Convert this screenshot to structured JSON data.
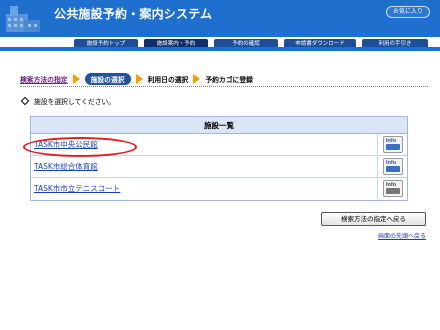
{
  "header": {
    "title": "公共施設予約・案内システム",
    "favorites_label": "お気に入り",
    "bg_color": "#1f6fcf"
  },
  "nav": {
    "tabs": [
      {
        "label": "施設予約トップ",
        "active": false
      },
      {
        "label": "施設案内・予約",
        "active": true
      },
      {
        "label": "予約の確認",
        "active": false
      },
      {
        "label": "申請書ダウンロード",
        "active": false
      },
      {
        "label": "利用の手引き",
        "active": false
      }
    ]
  },
  "breadcrumb": {
    "step1": "検索方法の指定",
    "step2": "施設の選択",
    "step3": "利用日の選択",
    "step4": "予約カゴに登録"
  },
  "instruction": "施設を選択してください。",
  "facility_table": {
    "header": "施設一覧",
    "rows": [
      {
        "name": "TASK市中央公民館",
        "info_icon": "info-icon",
        "highlighted": true
      },
      {
        "name": "TASK市総合体育館",
        "info_icon": "info-icon",
        "highlighted": false
      },
      {
        "name": "TASK市市立テニスコート",
        "info_icon": "info-icon-gray",
        "highlighted": false
      }
    ]
  },
  "back_button_label": "検索方法の指定へ戻る",
  "to_top_link": "画面の先頭へ戻る",
  "colors": {
    "accent": "#1f6fcf",
    "arrow": "#f0a000",
    "highlight_circle": "#e02020",
    "link": "#1a3fbf"
  }
}
